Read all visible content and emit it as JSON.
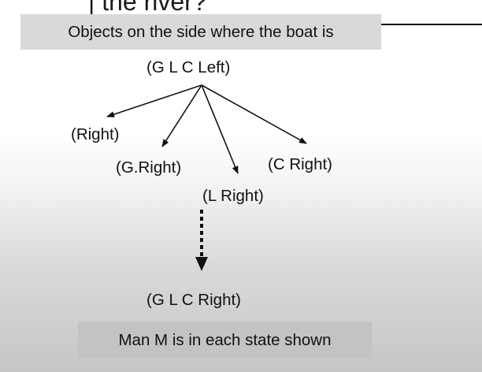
{
  "heading_fragment": "| the river?",
  "top_label": "Objects on the side where the boat is",
  "states": {
    "root": "(G L C Left)",
    "right": "(Right)",
    "g_right": "(G.Right)",
    "c_right": "(C Right)",
    "l_right": "(L Right)",
    "final": "(G L C Right)"
  },
  "bottom_label": "Man M is in each state shown",
  "colors": {
    "top_box": "#d9d9d9",
    "bottom_box": "#c3c3c3",
    "ink": "#111111"
  }
}
